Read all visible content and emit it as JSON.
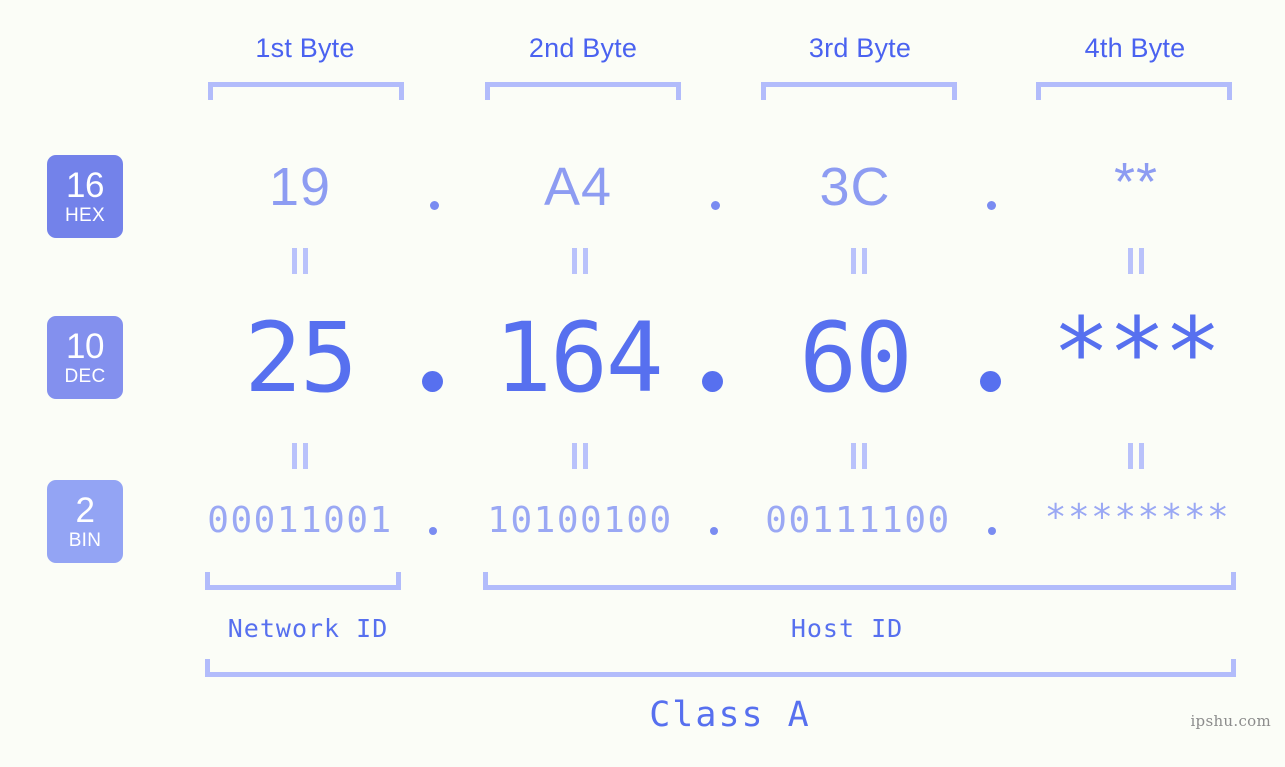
{
  "meta": {
    "watermark": "ipshu.com",
    "background_color": "#fbfdf7",
    "accent_color": "#5770ef",
    "bracket_color": "#b2bcfb"
  },
  "byte_headers": [
    {
      "label": "1st Byte"
    },
    {
      "label": "2nd Byte"
    },
    {
      "label": "3rd Byte"
    },
    {
      "label": "4th Byte"
    }
  ],
  "bases": [
    {
      "num": "16",
      "name": "HEX",
      "color": "#7382ea"
    },
    {
      "num": "10",
      "name": "DEC",
      "color": "#8390ee"
    },
    {
      "num": "2",
      "name": "BIN",
      "color": "#93a4f4"
    }
  ],
  "rows": {
    "hex": {
      "values": [
        "19",
        "A4",
        "3C",
        "**"
      ],
      "separator": "."
    },
    "dec": {
      "values": [
        "25",
        "164",
        "60",
        "***"
      ],
      "separator": "."
    },
    "bin": {
      "values": [
        "00011001",
        "10100100",
        "00111100",
        "********"
      ],
      "separator": "."
    }
  },
  "equals_marks": {
    "symbol": "||",
    "count_per_row": 4
  },
  "id_sections": [
    {
      "label": "Network ID"
    },
    {
      "label": "Host ID"
    }
  ],
  "class": {
    "label": "Class A"
  }
}
